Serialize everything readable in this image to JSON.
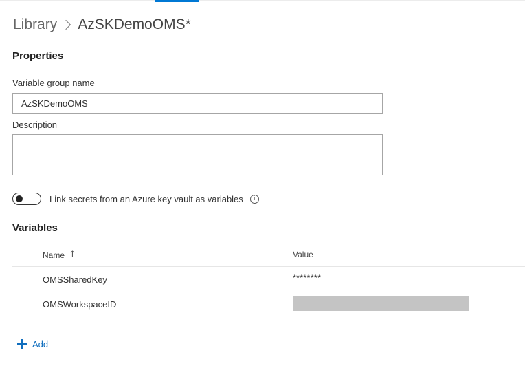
{
  "breadcrumb": {
    "root": "Library",
    "current": "AzSKDemoOMS*"
  },
  "properties": {
    "title": "Properties",
    "group_name_label": "Variable group name",
    "group_name_value": "AzSKDemoOMS",
    "description_label": "Description",
    "description_value": ""
  },
  "key_vault_toggle": {
    "label": "Link secrets from an Azure key vault as variables",
    "enabled": false,
    "info_icon": "info-icon"
  },
  "variables": {
    "title": "Variables",
    "columns": {
      "name": "Name",
      "value": "Value"
    },
    "sort_icon": "arrow-up-icon",
    "rows": [
      {
        "name": "OMSSharedKey",
        "value": "********"
      },
      {
        "name": "OMSWorkspaceID",
        "value": "",
        "redacted": true
      }
    ],
    "add_label": "Add"
  },
  "colors": {
    "accent": "#0078d4",
    "link": "#106ebe",
    "redaction": "#c4c4c4"
  }
}
